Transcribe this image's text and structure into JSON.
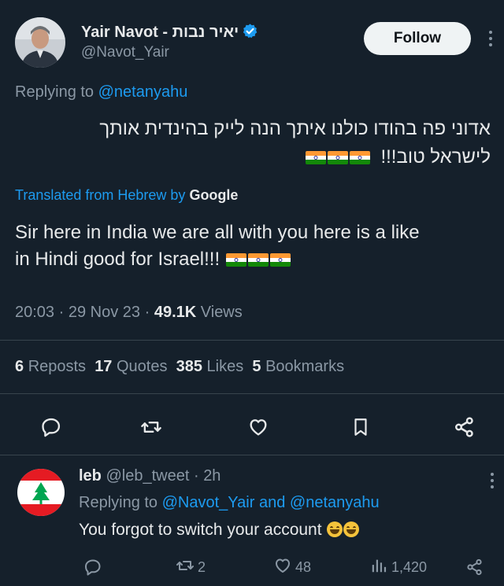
{
  "tweet": {
    "author_name": "Yair Navot - יאיר נבות",
    "author_handle": "@Navot_Yair",
    "follow_label": "Follow",
    "replying_prefix": "Replying to",
    "replying_to": "@netanyahu",
    "hebrew_line1": "אדוני פה בהודו כולנו איתך הנה לייק בהינדית אותך",
    "hebrew_line2": "לישראל טוב!!!",
    "translated_prefix": "Translated from Hebrew by",
    "translated_brand": "Google",
    "translation_line1": "Sir here in India we are all with you here is a like",
    "translation_line2": "in Hindi good for Israel!!!",
    "time": "20:03",
    "date": "29 Nov 23",
    "views_count": "49.1K",
    "views_label": "Views",
    "sep": "·",
    "reposts_count": "6",
    "reposts_label": "Reposts",
    "quotes_count": "17",
    "quotes_label": "Quotes",
    "likes_count": "385",
    "likes_label": "Likes",
    "bookmarks_count": "5",
    "bookmarks_label": "Bookmarks"
  },
  "reply": {
    "author_name": "leb",
    "author_handle": "@leb_tweet",
    "time_ago": "2h",
    "sep": "·",
    "replying_prefix": "Replying to",
    "replying_to_1": "@Navot_Yair",
    "replying_and": "and",
    "replying_to_2": "@netanyahu",
    "text": "You forgot to switch your account",
    "reposts": "2",
    "likes": "48",
    "views": "1,420"
  },
  "icons": [
    "verified-badge-icon",
    "more-options-icon",
    "india-flag-icon",
    "reply-icon",
    "repost-icon",
    "like-icon",
    "bookmark-icon",
    "share-icon",
    "lebanon-flag-avatar",
    "grinning-emoji-icon",
    "views-icon"
  ],
  "colors": {
    "background": "#15202b",
    "text": "#e7e9ea",
    "muted": "#8b98a5",
    "link": "#1d9bf0",
    "divider": "#38444d"
  }
}
